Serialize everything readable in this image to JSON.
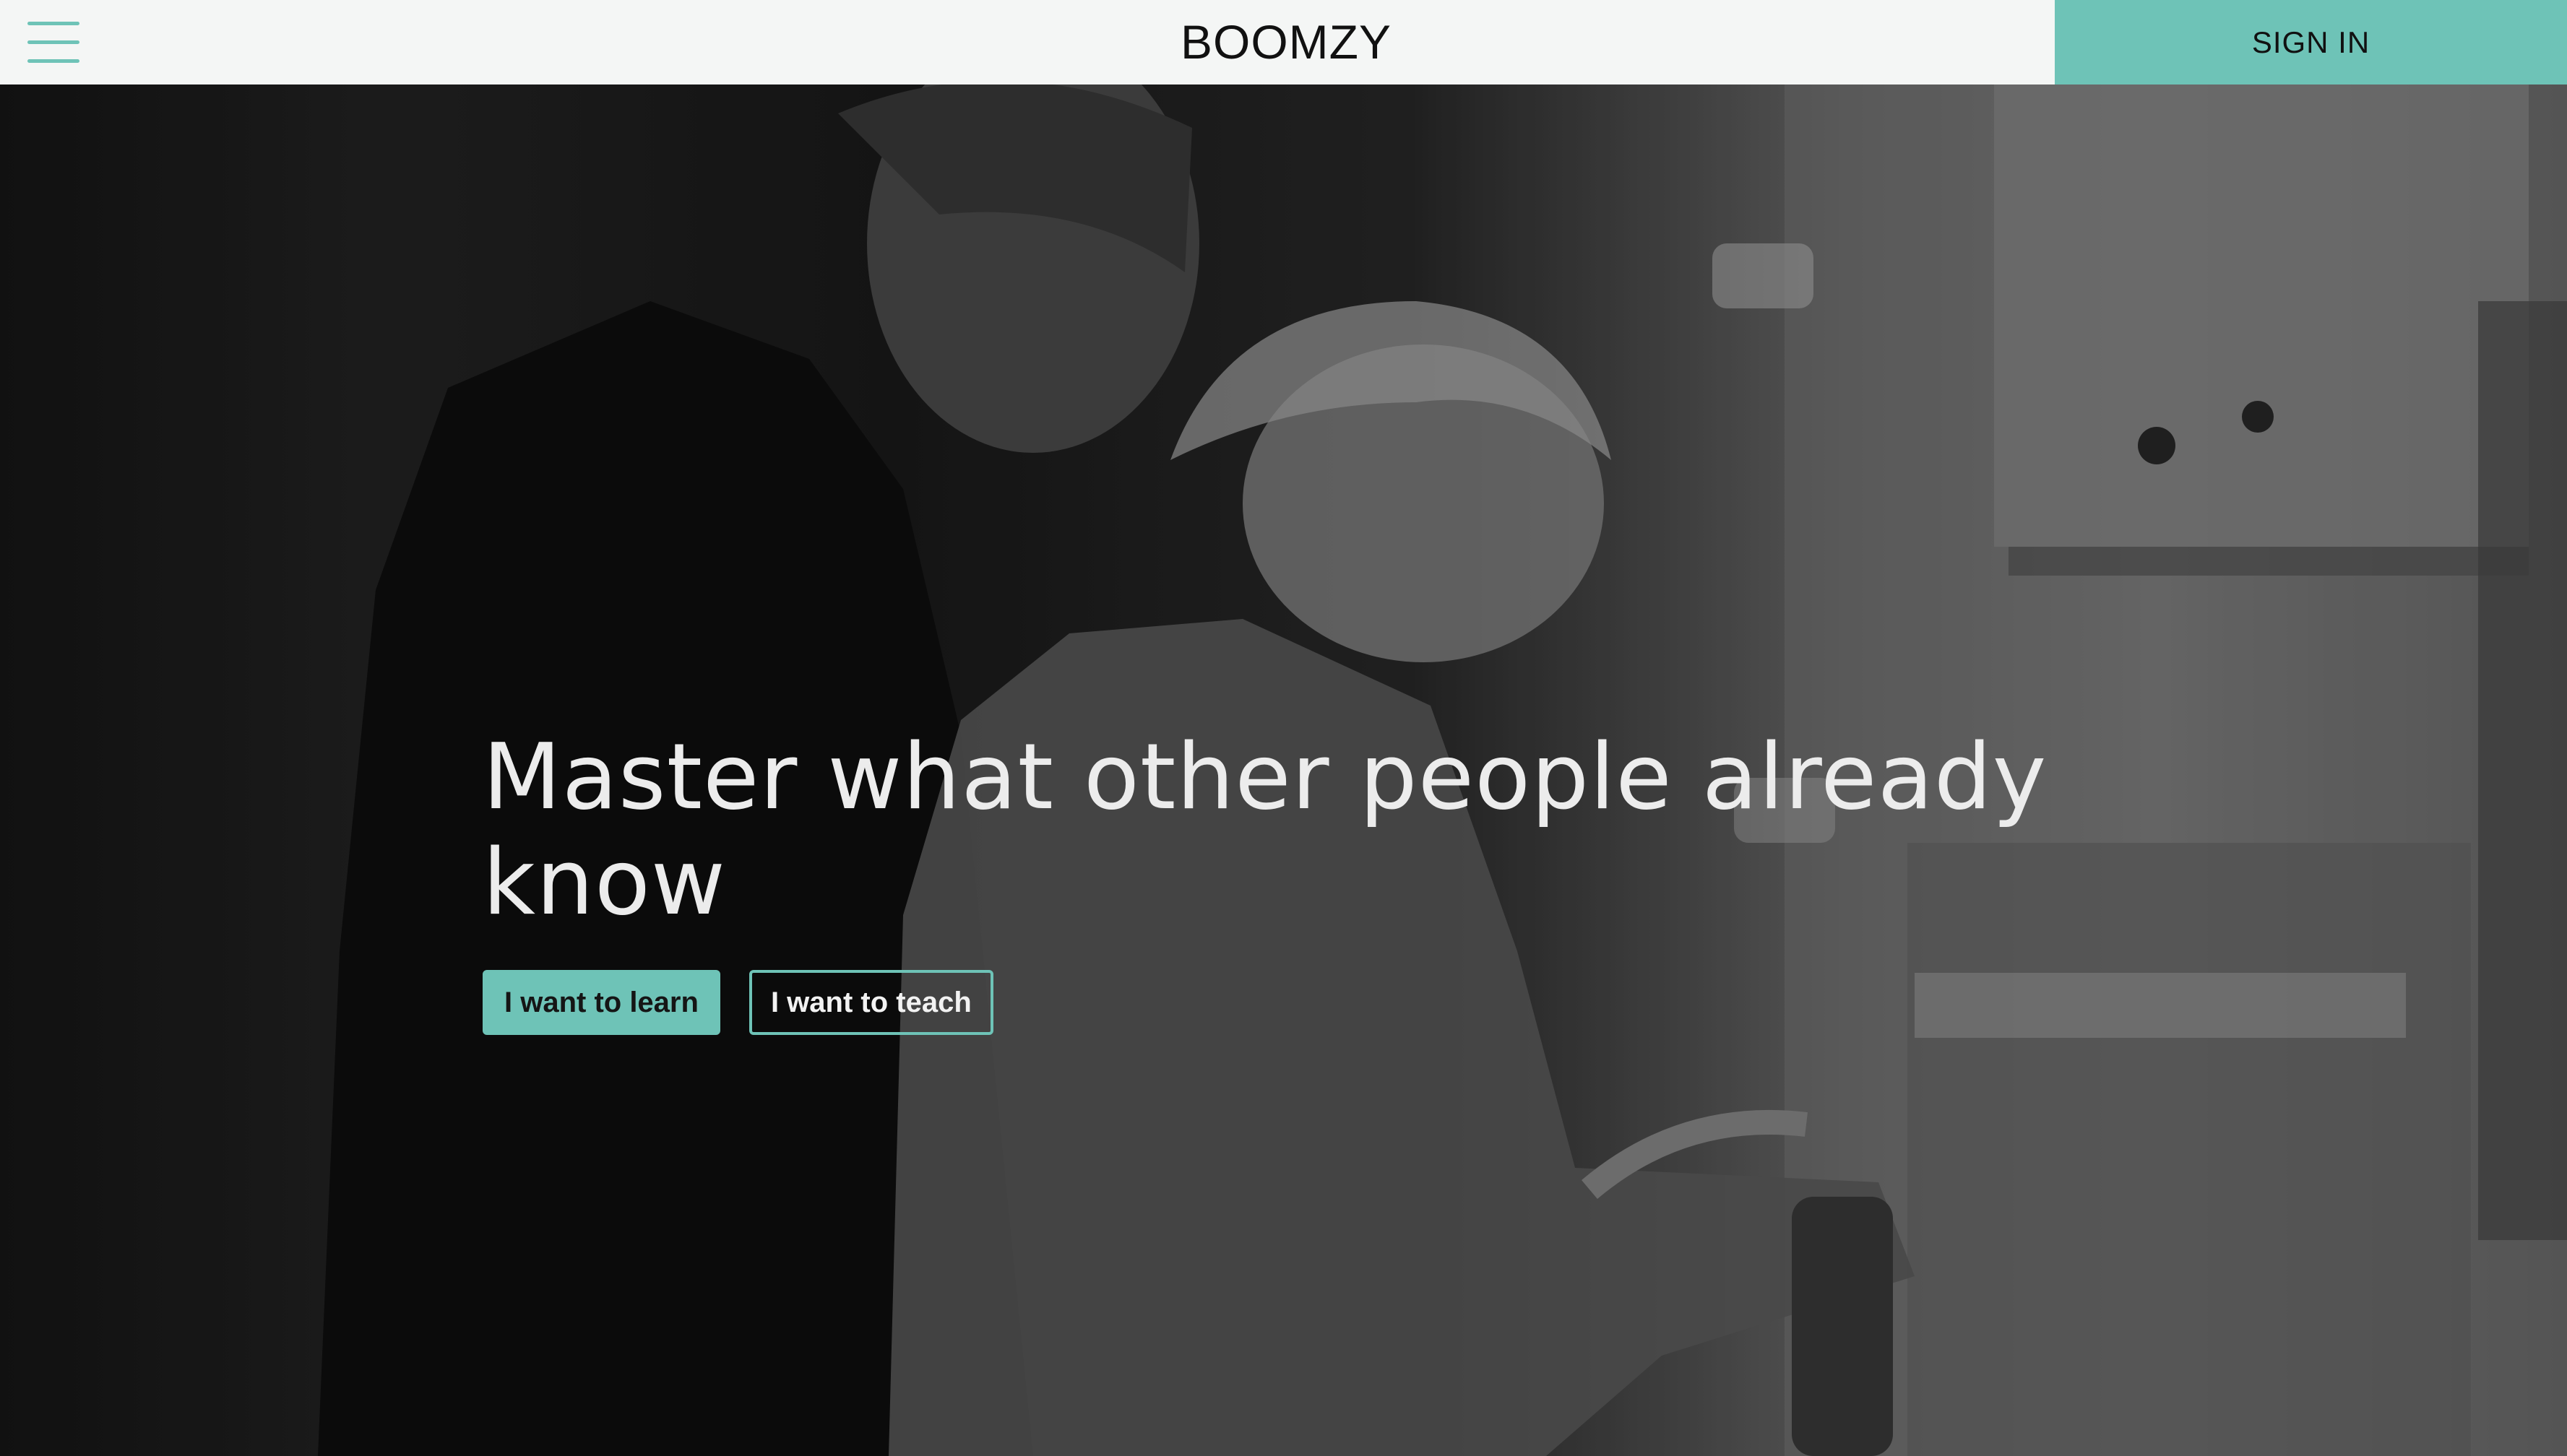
{
  "header": {
    "brand": "BOOMZY",
    "sign_in_label": "SIGN IN",
    "menu_icon": "hamburger-menu-icon"
  },
  "hero": {
    "headline": "Master what other people already know",
    "buttons": {
      "learn_label": "I want to learn",
      "teach_label": "I want to teach"
    },
    "image_description_icon": "workshop-photo"
  },
  "colors": {
    "accent": "#6ec3b7",
    "header_bg": "#f4f6f5",
    "headline_text": "#ececec"
  }
}
